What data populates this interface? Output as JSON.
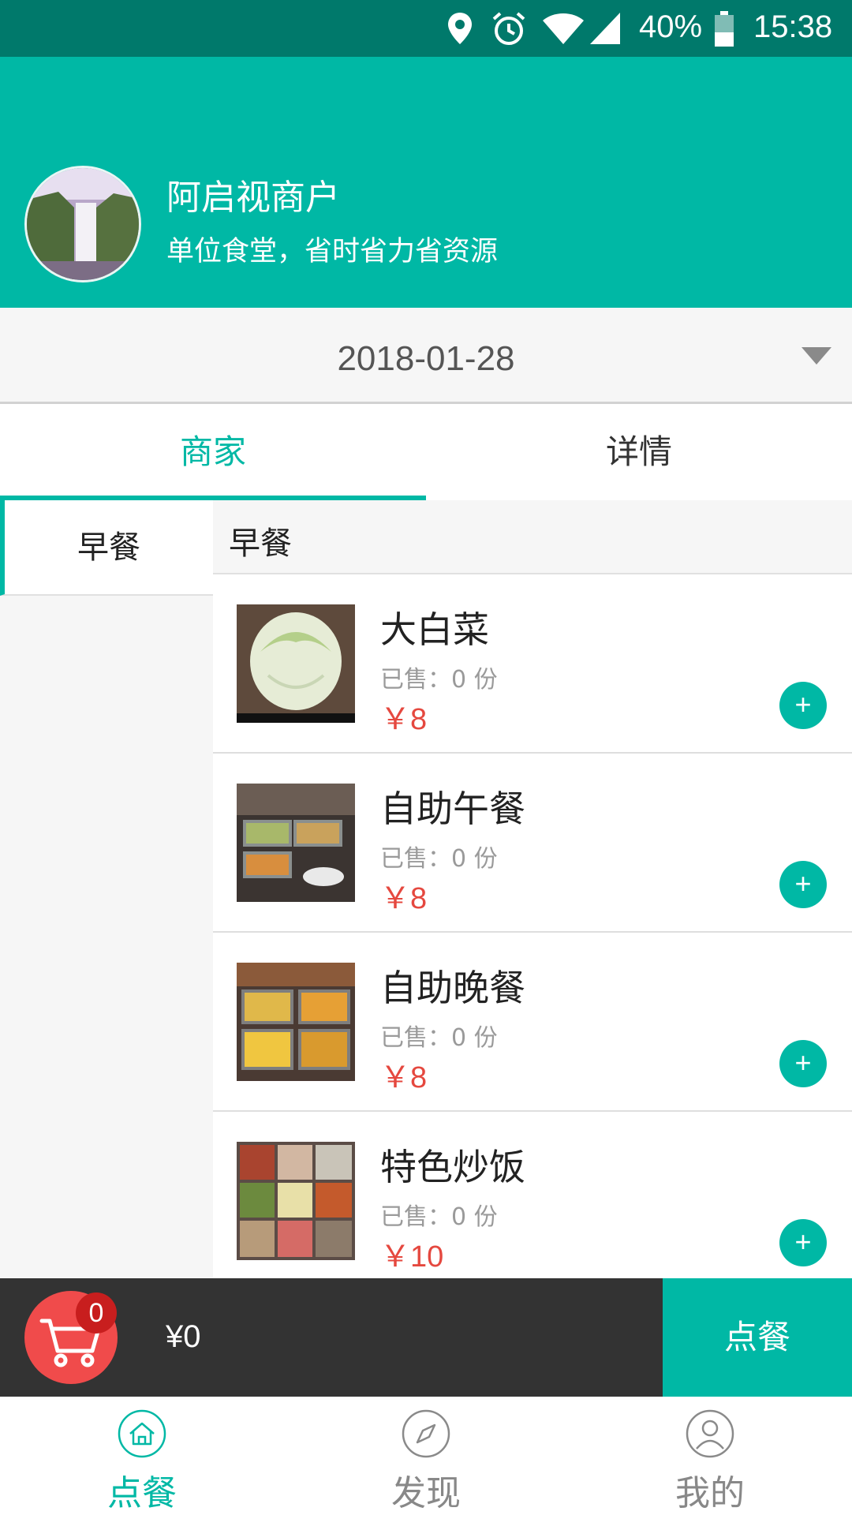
{
  "status_bar": {
    "battery": "40%",
    "time": "15:38",
    "icons": [
      "location-icon",
      "alarm-icon",
      "wifi-icon",
      "signal-icon",
      "battery-icon"
    ]
  },
  "header": {
    "store_name": "阿启视商户",
    "slogan": "单位食堂，省时省力省资源",
    "avatar_icon": "waterfall-avatar"
  },
  "date_picker": {
    "value": "2018-01-28",
    "icon": "dropdown-arrow-icon"
  },
  "tabs": [
    {
      "label": "商家",
      "active": true
    },
    {
      "label": "详情",
      "active": false
    }
  ],
  "categories": [
    {
      "label": "早餐",
      "selected": true
    }
  ],
  "section": {
    "title": "早餐"
  },
  "items": [
    {
      "name": "大白菜",
      "sold": "已售：0 份",
      "price": "￥8",
      "add_icon": "plus-icon"
    },
    {
      "name": "自助午餐",
      "sold": "已售：0 份",
      "price": "￥8",
      "add_icon": "plus-icon"
    },
    {
      "name": "自助晚餐",
      "sold": "已售：0 份",
      "price": "￥8",
      "add_icon": "plus-icon"
    },
    {
      "name": "特色炒饭",
      "sold": "已售：0 份",
      "price": "￥10",
      "add_icon": "plus-icon"
    }
  ],
  "cart": {
    "count": "0",
    "total": "¥0",
    "order_label": "点餐"
  },
  "bottom_nav": [
    {
      "label": "点餐",
      "icon": "home-icon",
      "active": true
    },
    {
      "label": "发现",
      "icon": "compass-icon",
      "active": false
    },
    {
      "label": "我的",
      "icon": "user-icon",
      "active": false
    }
  ],
  "colors": {
    "accent": "#00b8a5",
    "status_bar": "#00796b",
    "price": "#e5483f",
    "cart_bar": "#333333",
    "cart_circle": "#f04b4b"
  }
}
